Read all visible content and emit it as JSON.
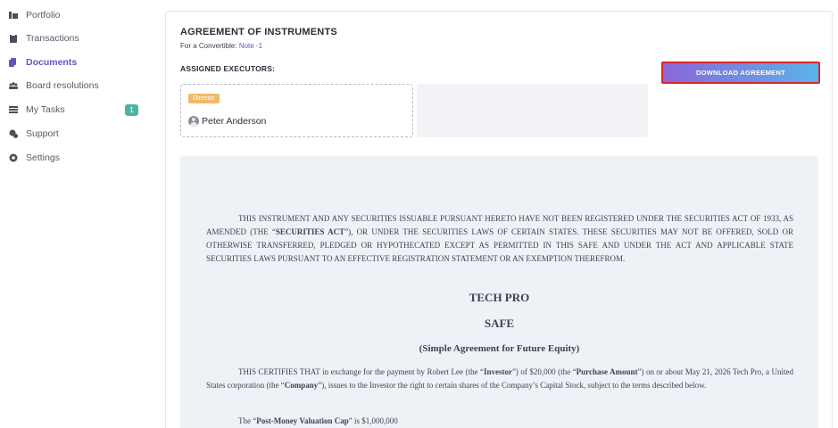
{
  "sidebar": {
    "items": [
      {
        "label": "Portfolio",
        "icon": "portfolio-icon"
      },
      {
        "label": "Transactions",
        "icon": "clipboard-icon"
      },
      {
        "label": "Documents",
        "icon": "documents-icon"
      },
      {
        "label": "Board resolutions",
        "icon": "board-icon"
      },
      {
        "label": "My Tasks",
        "icon": "tasks-icon"
      },
      {
        "label": "Support",
        "icon": "support-icon"
      },
      {
        "label": "Settings",
        "icon": "gear-icon"
      }
    ],
    "tasks_badge": "1",
    "active": "Documents",
    "accent_color": "#6b4fc4",
    "badge_color": "#4fb3a3"
  },
  "card": {
    "title": "AGREEMENT OF INSTRUMENTS",
    "subtitle_prefix": "For a Convertible: ",
    "subtitle_note": "Note -1",
    "executors_label": "ASSIGNED EXECUTORS:",
    "download_label": "DOWNLOAD AGREEMENT",
    "executor": {
      "role": "Director",
      "name": "Peter Anderson"
    }
  },
  "document": {
    "para1": "THIS INSTRUMENT AND ANY SECURITIES ISSUABLE PURSUANT HERETO HAVE NOT BEEN REGISTERED UNDER THE SECURITIES ACT OF 1933, AS AMENDED (THE “",
    "para1_bold": "SECURITIES ACT",
    "para1_rest": "”), OR UNDER THE SECURITIES LAWS OF CERTAIN STATES. THESE SECURITIES MAY NOT BE OFFERED, SOLD OR OTHERWISE TRANSFERRED, PLEDGED OR HYPOTHECATED EXCEPT AS PERMITTED IN THIS SAFE AND UNDER THE ACT AND APPLICABLE STATE SECURITIES LAWS PURSUANT TO AN EFFECTIVE REGISTRATION STATEMENT OR AN EXEMPTION THEREFROM.",
    "company": "TECH PRO",
    "safe": "SAFE",
    "safe_full": "(Simple Agreement for Future Equity)",
    "p2_a": "THIS CERTIFIES THAT in exchange for the payment by Robert Lee (the “",
    "p2_investor": "Investor",
    "p2_b": "”) of $20,000 (the “",
    "p2_amount": "Purchase Amount",
    "p2_c": "”) on or about May 21, 2026 Tech Pro, a United States corporation (the “",
    "p2_company": "Company",
    "p2_d": "”), issues to the Investor the right to certain shares of the Company’s Capital Stock, subject to the terms described below.",
    "p3_a": "The “",
    "p3_cap": "Post-Money Valuation Cap",
    "p3_b": "” is $1,000,000"
  }
}
